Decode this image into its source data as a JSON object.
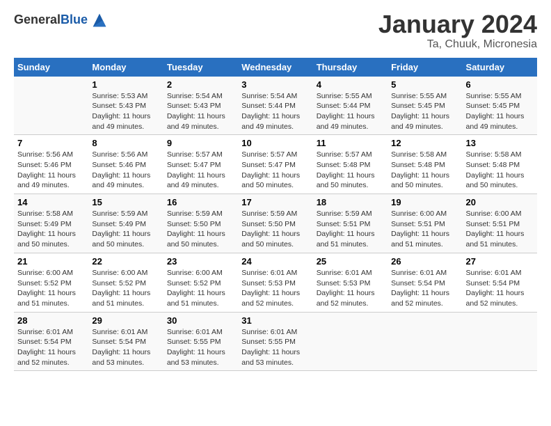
{
  "logo": {
    "general": "General",
    "blue": "Blue"
  },
  "title": "January 2024",
  "subtitle": "Ta, Chuuk, Micronesia",
  "days_header": [
    "Sunday",
    "Monday",
    "Tuesday",
    "Wednesday",
    "Thursday",
    "Friday",
    "Saturday"
  ],
  "weeks": [
    [
      {
        "day": "",
        "info": ""
      },
      {
        "day": "1",
        "info": "Sunrise: 5:53 AM\nSunset: 5:43 PM\nDaylight: 11 hours\nand 49 minutes."
      },
      {
        "day": "2",
        "info": "Sunrise: 5:54 AM\nSunset: 5:43 PM\nDaylight: 11 hours\nand 49 minutes."
      },
      {
        "day": "3",
        "info": "Sunrise: 5:54 AM\nSunset: 5:44 PM\nDaylight: 11 hours\nand 49 minutes."
      },
      {
        "day": "4",
        "info": "Sunrise: 5:55 AM\nSunset: 5:44 PM\nDaylight: 11 hours\nand 49 minutes."
      },
      {
        "day": "5",
        "info": "Sunrise: 5:55 AM\nSunset: 5:45 PM\nDaylight: 11 hours\nand 49 minutes."
      },
      {
        "day": "6",
        "info": "Sunrise: 5:55 AM\nSunset: 5:45 PM\nDaylight: 11 hours\nand 49 minutes."
      }
    ],
    [
      {
        "day": "7",
        "info": "Sunrise: 5:56 AM\nSunset: 5:46 PM\nDaylight: 11 hours\nand 49 minutes."
      },
      {
        "day": "8",
        "info": "Sunrise: 5:56 AM\nSunset: 5:46 PM\nDaylight: 11 hours\nand 49 minutes."
      },
      {
        "day": "9",
        "info": "Sunrise: 5:57 AM\nSunset: 5:47 PM\nDaylight: 11 hours\nand 49 minutes."
      },
      {
        "day": "10",
        "info": "Sunrise: 5:57 AM\nSunset: 5:47 PM\nDaylight: 11 hours\nand 50 minutes."
      },
      {
        "day": "11",
        "info": "Sunrise: 5:57 AM\nSunset: 5:48 PM\nDaylight: 11 hours\nand 50 minutes."
      },
      {
        "day": "12",
        "info": "Sunrise: 5:58 AM\nSunset: 5:48 PM\nDaylight: 11 hours\nand 50 minutes."
      },
      {
        "day": "13",
        "info": "Sunrise: 5:58 AM\nSunset: 5:48 PM\nDaylight: 11 hours\nand 50 minutes."
      }
    ],
    [
      {
        "day": "14",
        "info": "Sunrise: 5:58 AM\nSunset: 5:49 PM\nDaylight: 11 hours\nand 50 minutes."
      },
      {
        "day": "15",
        "info": "Sunrise: 5:59 AM\nSunset: 5:49 PM\nDaylight: 11 hours\nand 50 minutes."
      },
      {
        "day": "16",
        "info": "Sunrise: 5:59 AM\nSunset: 5:50 PM\nDaylight: 11 hours\nand 50 minutes."
      },
      {
        "day": "17",
        "info": "Sunrise: 5:59 AM\nSunset: 5:50 PM\nDaylight: 11 hours\nand 50 minutes."
      },
      {
        "day": "18",
        "info": "Sunrise: 5:59 AM\nSunset: 5:51 PM\nDaylight: 11 hours\nand 51 minutes."
      },
      {
        "day": "19",
        "info": "Sunrise: 6:00 AM\nSunset: 5:51 PM\nDaylight: 11 hours\nand 51 minutes."
      },
      {
        "day": "20",
        "info": "Sunrise: 6:00 AM\nSunset: 5:51 PM\nDaylight: 11 hours\nand 51 minutes."
      }
    ],
    [
      {
        "day": "21",
        "info": "Sunrise: 6:00 AM\nSunset: 5:52 PM\nDaylight: 11 hours\nand 51 minutes."
      },
      {
        "day": "22",
        "info": "Sunrise: 6:00 AM\nSunset: 5:52 PM\nDaylight: 11 hours\nand 51 minutes."
      },
      {
        "day": "23",
        "info": "Sunrise: 6:00 AM\nSunset: 5:52 PM\nDaylight: 11 hours\nand 51 minutes."
      },
      {
        "day": "24",
        "info": "Sunrise: 6:01 AM\nSunset: 5:53 PM\nDaylight: 11 hours\nand 52 minutes."
      },
      {
        "day": "25",
        "info": "Sunrise: 6:01 AM\nSunset: 5:53 PM\nDaylight: 11 hours\nand 52 minutes."
      },
      {
        "day": "26",
        "info": "Sunrise: 6:01 AM\nSunset: 5:54 PM\nDaylight: 11 hours\nand 52 minutes."
      },
      {
        "day": "27",
        "info": "Sunrise: 6:01 AM\nSunset: 5:54 PM\nDaylight: 11 hours\nand 52 minutes."
      }
    ],
    [
      {
        "day": "28",
        "info": "Sunrise: 6:01 AM\nSunset: 5:54 PM\nDaylight: 11 hours\nand 52 minutes."
      },
      {
        "day": "29",
        "info": "Sunrise: 6:01 AM\nSunset: 5:54 PM\nDaylight: 11 hours\nand 53 minutes."
      },
      {
        "day": "30",
        "info": "Sunrise: 6:01 AM\nSunset: 5:55 PM\nDaylight: 11 hours\nand 53 minutes."
      },
      {
        "day": "31",
        "info": "Sunrise: 6:01 AM\nSunset: 5:55 PM\nDaylight: 11 hours\nand 53 minutes."
      },
      {
        "day": "",
        "info": ""
      },
      {
        "day": "",
        "info": ""
      },
      {
        "day": "",
        "info": ""
      }
    ]
  ]
}
